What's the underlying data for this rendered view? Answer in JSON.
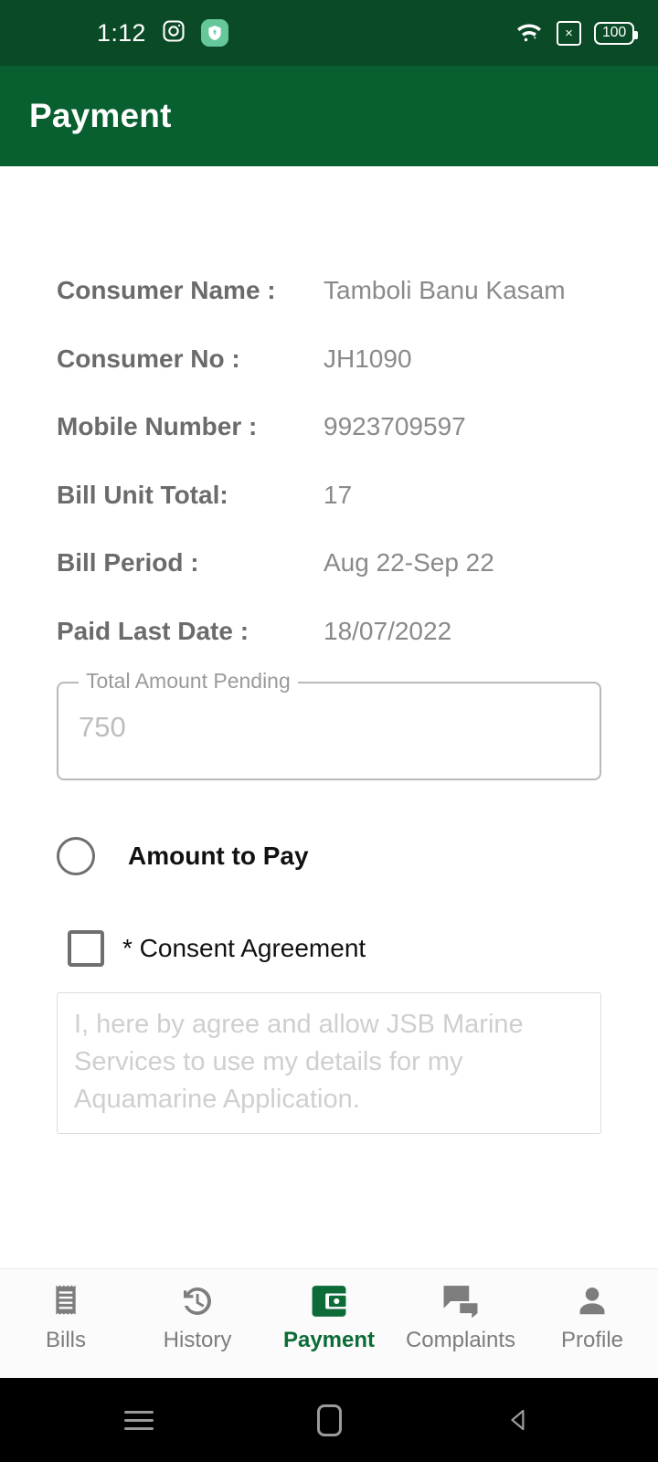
{
  "status_bar": {
    "clock": "1:12",
    "icons_left": [
      "instagram-icon",
      "shield-icon"
    ],
    "icons_right": [
      "wifi-icon",
      "signal-off-icon",
      "battery-icon"
    ],
    "battery_level": "100",
    "signal_off_glyph": "×",
    "background_color": "#0b4a26"
  },
  "app_bar": {
    "title": "Payment",
    "background_color": "#086030",
    "title_color": "#ffffff"
  },
  "details": [
    {
      "label": "Consumer Name :",
      "value": "Tamboli Banu Kasam"
    },
    {
      "label": "Consumer No :",
      "value": "JH1090"
    },
    {
      "label": "Mobile Number :",
      "value": "9923709597"
    },
    {
      "label": "Bill Unit Total:",
      "value": "17"
    },
    {
      "label": "Bill Period :",
      "value": "Aug 22-Sep 22"
    },
    {
      "label": "Paid Last Date :",
      "value": "18/07/2022"
    }
  ],
  "amount_field": {
    "label": "Total Amount Pending",
    "value": "750"
  },
  "amount_to_pay": {
    "label": "Amount to Pay",
    "selected": false
  },
  "consent": {
    "checkbox_label": "* Consent Agreement",
    "checked": false,
    "text": "I, here by agree and allow JSB Marine Services to use my details for my Aquamarine Application."
  },
  "bottom_nav": {
    "active_color": "#0d6b38",
    "inactive_color": "#7d7d7d",
    "items": [
      {
        "label": "Bills",
        "icon": "receipt-icon",
        "active": false
      },
      {
        "label": "History",
        "icon": "history-clock-icon",
        "active": false
      },
      {
        "label": "Payment",
        "icon": "wallet-icon",
        "active": true
      },
      {
        "label": "Complaints",
        "icon": "chat-bubbles-icon",
        "active": false
      },
      {
        "label": "Profile",
        "icon": "person-icon",
        "active": false
      }
    ]
  },
  "system_nav": {
    "buttons": [
      "recents-button",
      "home-button",
      "back-button"
    ]
  }
}
